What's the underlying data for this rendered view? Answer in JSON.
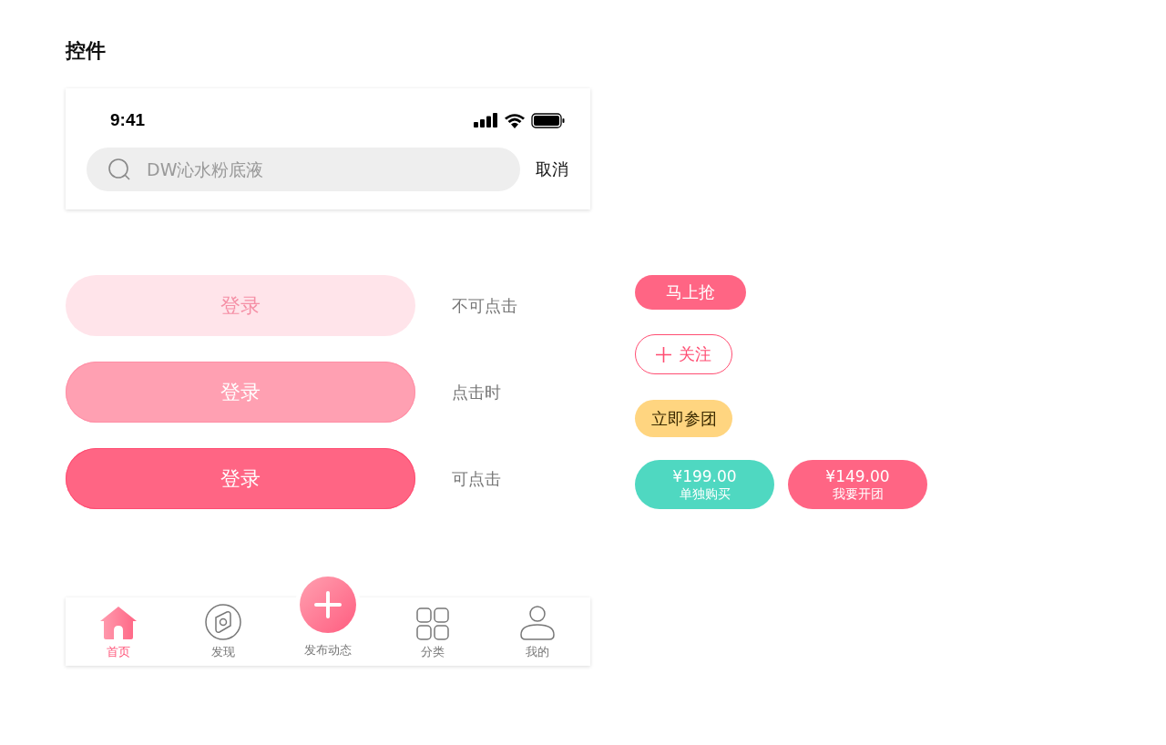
{
  "page_title": "控件",
  "search_panel": {
    "status_bar": {
      "time": "9:41"
    },
    "search": {
      "placeholder": "DW沁水粉底液"
    },
    "cancel": "取消"
  },
  "login_buttons": [
    {
      "label": "登录",
      "kind": "disabled",
      "caption": "不可点击"
    },
    {
      "label": "登录",
      "kind": "pressed",
      "caption": "点击时"
    },
    {
      "label": "登录",
      "kind": "normal",
      "caption": "可点击"
    }
  ],
  "tags": [
    {
      "kind": "solid",
      "label": "马上抢"
    },
    {
      "kind": "follow",
      "label": "关注"
    },
    {
      "kind": "yellow",
      "label": "立即参团"
    }
  ],
  "price_buttons": [
    {
      "price": "¥199.00",
      "label": "单独购买",
      "color": "#4fd8c1"
    },
    {
      "price": "¥149.00",
      "label": "我要开团",
      "color": "#ff6584"
    }
  ],
  "tab_bar": [
    {
      "kind": "home",
      "label": "首页",
      "selected": true
    },
    {
      "kind": "discover",
      "label": "发现",
      "selected": false
    },
    {
      "kind": "publish",
      "label": "发布动态",
      "selected": false
    },
    {
      "kind": "category",
      "label": "分类",
      "selected": false
    },
    {
      "kind": "profile",
      "label": "我的",
      "selected": false
    }
  ]
}
